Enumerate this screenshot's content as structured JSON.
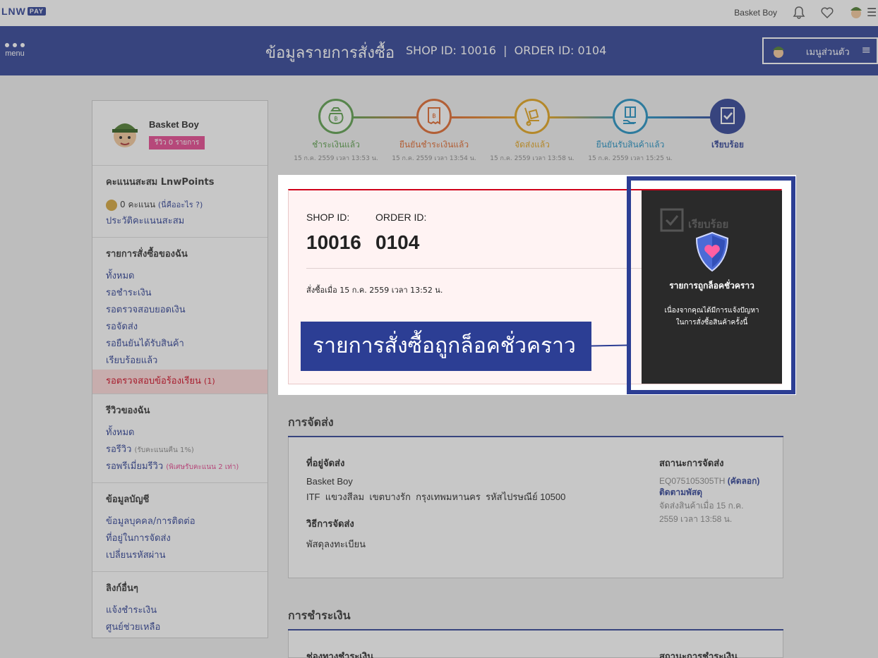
{
  "topbar": {
    "logo": "LNW",
    "logo_pay": "PAY",
    "username": "Basket Boy"
  },
  "header": {
    "menu_label": "menu",
    "title": "ข้อมูลรายการสั่งซื้อ",
    "ids": "SHOP ID: 10016  |  ORDER ID: 0104",
    "personal_menu": "เมนูส่วนตัว"
  },
  "sidebar": {
    "name": "Basket Boy",
    "review_badge": "รีวิว 0 รายการ",
    "points_title": "คะแนนสะสม LnwPoints",
    "points_text": "0 คะแนน",
    "points_help": "(นี่คืออะไร ?)",
    "points_history": "ประวัติคะแนนสะสม",
    "orders_title": "รายการสั่งซื้อของฉัน",
    "orders": [
      "ทั้งหมด",
      "รอชำระเงิน",
      "รอตรวจสอบยอดเงิน",
      "รอจัดส่ง",
      "รอยืนยันได้รับสินค้า",
      "เรียบร้อยแล้ว"
    ],
    "orders_active": "รอตรวจสอบข้อร้องเรียน",
    "orders_active_count": "(1)",
    "reviews_title": "รีวิวของฉัน",
    "review_all": "ทั้งหมด",
    "review_wait": "รอรีวิว",
    "review_wait_note": "(รับคะแนนคืน 1%)",
    "review_premium": "รอพรีเมี่ยมรีวิว",
    "review_premium_note": "(พิเศษรับคะแนน 2 เท่า)",
    "account_title": "ข้อมูลบัญชี",
    "account": [
      "ข้อมูลบุคคล/การติดต่อ",
      "ที่อยู่ในการจัดส่ง",
      "เปลี่ยนรหัสผ่าน"
    ],
    "links_title": "ลิงก์อื่นๆ",
    "links": [
      "แจ้งชำระเงิน",
      "ศูนย์ช่วยเหลือ"
    ]
  },
  "steps": [
    {
      "label": "ชำระเงินแล้ว",
      "date": "15 ก.ค. 2559 เวลา 13:53 น.",
      "color": "#5a9e4b"
    },
    {
      "label": "ยืนยันชำระเงินแล้ว",
      "date": "15 ก.ค. 2559 เวลา 13:54 น.",
      "color": "#e0662a"
    },
    {
      "label": "จัดส่งแล้ว",
      "date": "15 ก.ค. 2559 เวลา 13:58 น.",
      "color": "#e3a219"
    },
    {
      "label": "ยืนยันรับสินค้าแล้ว",
      "date": "15 ก.ค. 2559 เวลา 15:25 น.",
      "color": "#1e8fc2"
    },
    {
      "label": "เรียบร้อย",
      "date": "",
      "color": "#2c3e94"
    }
  ],
  "order": {
    "shop_label": "SHOP ID:",
    "order_label": "ORDER ID:",
    "shop_id": "10016",
    "order_id": "0104",
    "ordered_at": "สั่งซื้อเมื่อ 15 ก.ค. 2559 เวลา 13:52 น."
  },
  "lock": {
    "title": "รายการถูกล็อคชั่วคราว",
    "desc1": "เนื่องจากคุณได้มีการแจ้งปัญหา",
    "desc2": "ในการสั่งซื้อสินค้าครั้งนี้",
    "bg_status": "เรียบร้อย"
  },
  "callout": "รายการสั่งซื้อถูกล็อคชั่วคราว",
  "shipping": {
    "title": "การจัดส่ง",
    "addr_h": "ที่อยู่จัดส่ง",
    "addr_name": "Basket Boy",
    "addr_line": "ITF  แขวงสีลม  เขตบางรัก  กรุงเทพมหานคร  รหัสไปรษณีย์ 10500",
    "method_h": "วิธีการจัดส่ง",
    "method": "พัสดุลงทะเบียน",
    "status_h": "สถานะการจัดส่ง",
    "tracking": "EQ075105305TH",
    "copy": "(คัดลอก)",
    "track_link": "ติดตามพัสดุ",
    "sent1": "จัดส่งสินค้าเมื่อ 15 ก.ค.",
    "sent2": "2559 เวลา 13:58 น."
  },
  "payment": {
    "title": "การชำระเงิน",
    "channel_h": "ช่องทางชำระเงิน",
    "status_h": "สถานะการชำระเงิน"
  }
}
